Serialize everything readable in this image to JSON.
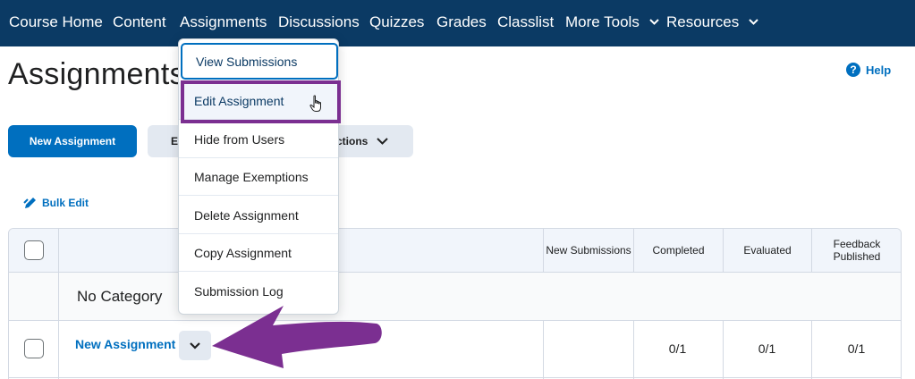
{
  "nav": {
    "items": [
      "Course Home",
      "Content",
      "Assignments",
      "Discussions",
      "Quizzes",
      "Grades",
      "Classlist"
    ],
    "more_tools": "More Tools",
    "resources": "Resources"
  },
  "page": {
    "title": "Assignments",
    "help": "Help"
  },
  "toolbar": {
    "new_assignment": "New Assignment",
    "edit_partial": "E",
    "more_actions_partial": "ctions",
    "bulk_edit": "Bulk Edit"
  },
  "table": {
    "headers": {
      "new_submissions": "New Submissions",
      "completed": "Completed",
      "evaluated": "Evaluated",
      "feedback_published": "Feedback Published"
    },
    "category": "No Category",
    "rows": [
      {
        "name": "New Assignment",
        "completed": "0/1",
        "evaluated": "0/1",
        "feedback_published": "0/1"
      }
    ]
  },
  "menu": {
    "items": [
      "View Submissions",
      "Edit Assignment",
      "Hide from Users",
      "Manage Exemptions",
      "Delete Assignment",
      "Copy Assignment",
      "Submission Log"
    ]
  },
  "colors": {
    "nav_bg": "#0b3a64",
    "accent": "#006fbf",
    "highlight": "#7b2f91"
  }
}
